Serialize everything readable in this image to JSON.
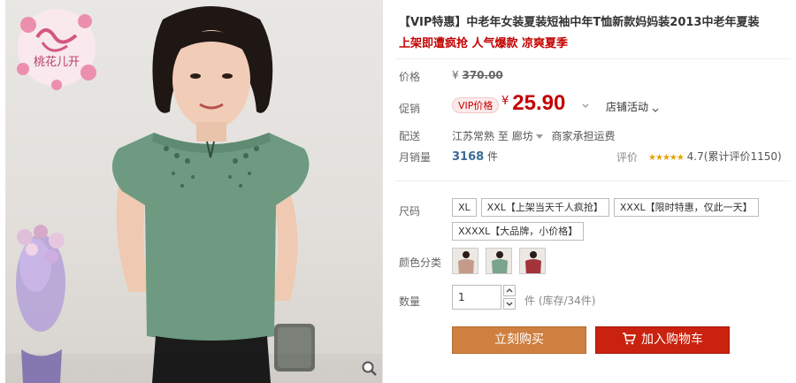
{
  "brand": {
    "logo_text": "桃花儿开"
  },
  "product": {
    "title": "【VIP特惠】中老年女装夏装短袖中年T恤新款妈妈装2013中老年夏装",
    "subtitle": "上架即遭疯抢 人气爆款 凉爽夏季"
  },
  "price": {
    "label": "价格",
    "currency": "¥",
    "original": "370.00"
  },
  "promo": {
    "label": "促销",
    "badge": "VIP价格",
    "currency": "¥",
    "price": "25.90",
    "store_activity": "店铺活动"
  },
  "shipping": {
    "label": "配送",
    "from": "江苏常熟",
    "to_prefix": "至",
    "to": "廊坊",
    "note": "商家承担运费"
  },
  "sales": {
    "label": "月销量",
    "count": "3168",
    "unit": "件",
    "rating_label": "评价",
    "rating_score": "4.7",
    "rating_count_text": "(累计评价1150)",
    "stars": 4.7
  },
  "sizes": {
    "label": "尺码",
    "options": [
      "XL",
      "XXL【上架当天千人疯抢】",
      "XXXL【限时特惠，仅此一天】",
      "XXXXL【大品牌，小价格】"
    ]
  },
  "colors": {
    "label": "颜色分类",
    "swatches": [
      "#c49a8a",
      "#7aa48c",
      "#a2343a"
    ]
  },
  "quantity": {
    "label": "数量",
    "value": "1",
    "stock_text": "件 (库存/34件)"
  },
  "actions": {
    "buy_now": "立刻购买",
    "add_to_cart": "加入购物车"
  },
  "colors_theme": {
    "price_red": "#c40000",
    "buy_orange": "#cf7f3f",
    "cart_red": "#c9220e",
    "star_gold": "#e8a100"
  }
}
